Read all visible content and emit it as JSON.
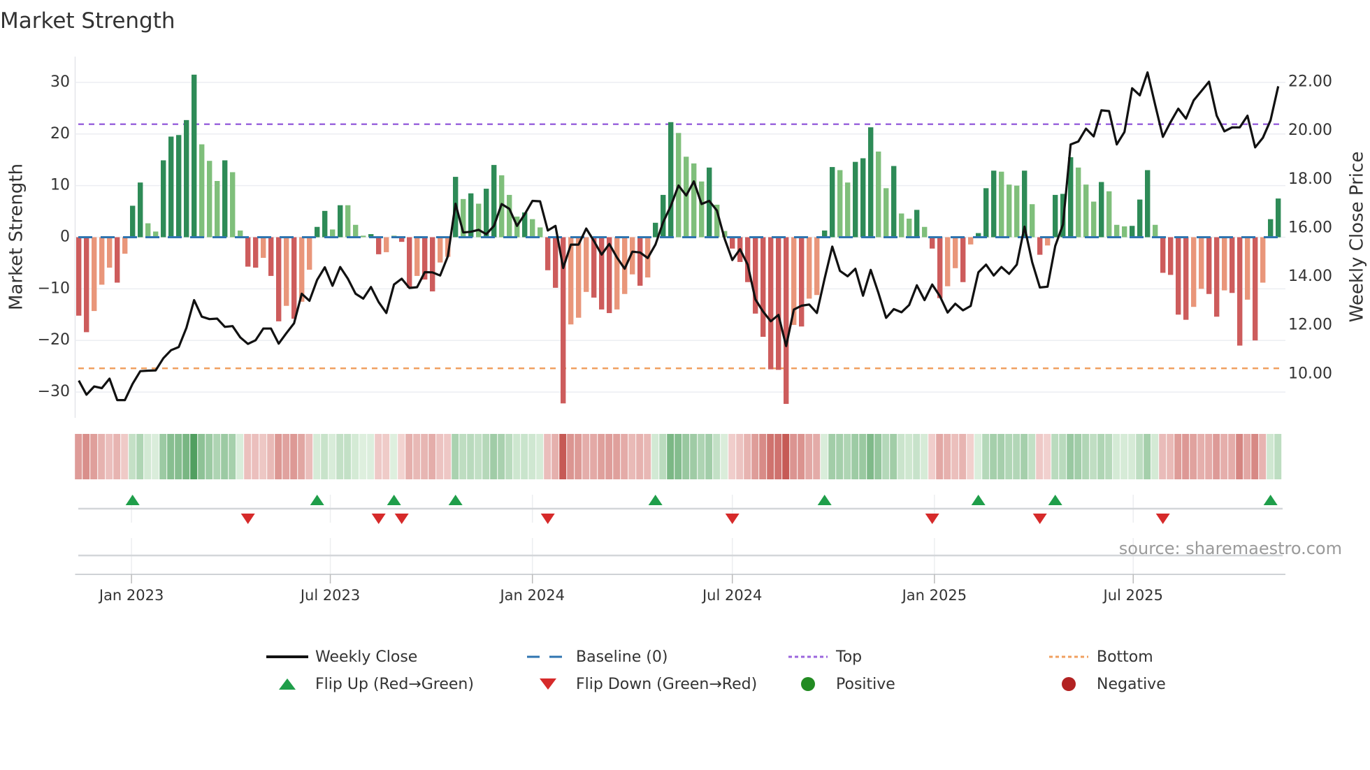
{
  "title": "Market Strength",
  "source": "source: sharemaestro.com",
  "colors": {
    "strong_pos": "#2e8b57",
    "weak_pos": "#7fbf7b",
    "strong_neg": "#cd5c5c",
    "weak_neg": "#e9967a",
    "close": "#111111",
    "baseline": "#2f74b0",
    "top": "#9b66dd",
    "bottom": "#f0a060",
    "flip_up": "#1f9e4a",
    "flip_down": "#d62a2a",
    "positive": "#228b22",
    "negative": "#b22222"
  },
  "legend": {
    "weekly_close": "Weekly Close",
    "baseline": "Baseline (0)",
    "top": "Top",
    "bottom": "Bottom",
    "flip_up": "Flip Up (Red→Green)",
    "flip_down": "Flip Down (Green→Red)",
    "positive": "Positive",
    "negative": "Negative"
  },
  "chart_data": {
    "type": "bar",
    "title": "Market Strength",
    "ylabel": "Market Strength",
    "y2label": "Weekly Close Price",
    "ylim": [
      -35,
      35
    ],
    "y2lim": [
      8.2,
      23.05
    ],
    "yticks": [
      "30",
      "20",
      "10",
      "0",
      "−10",
      "−20",
      "−30"
    ],
    "ytick_values": [
      30,
      20,
      10,
      0,
      -10,
      -20,
      -30
    ],
    "y2ticks": [
      "22.00",
      "20.00",
      "18.00",
      "16.00",
      "14.00",
      "12.00",
      "10.00"
    ],
    "y2tick_values": [
      22,
      20,
      18,
      16,
      14,
      12,
      10
    ],
    "start_date": "2022-11-14",
    "frequency": "weekly",
    "xticks": [
      {
        "label": "Jan 2023",
        "date": "2023-01-01"
      },
      {
        "label": "Jul 2023",
        "date": "2023-07-01"
      },
      {
        "label": "Jan 2024",
        "date": "2024-01-01"
      },
      {
        "label": "Jul 2024",
        "date": "2024-07-01"
      },
      {
        "label": "Jan 2025",
        "date": "2025-01-01"
      },
      {
        "label": "Jul 2025",
        "date": "2025-07-01"
      }
    ],
    "top_level": 21.9,
    "bottom_level": -25.4,
    "grid": true,
    "legend_position": "bottom",
    "strength": [
      -15.2,
      -18.4,
      -14.3,
      -9.2,
      -5.9,
      -8.8,
      -3.2,
      6.1,
      10.6,
      2.7,
      1.1,
      14.9,
      19.5,
      19.8,
      22.7,
      31.5,
      18.0,
      14.8,
      10.9,
      14.9,
      12.6,
      1.3,
      -5.7,
      -5.9,
      -4.0,
      -7.5,
      -16.3,
      -13.3,
      -15.8,
      -12.5,
      -6.3,
      2.0,
      5.1,
      1.5,
      6.2,
      6.2,
      2.4,
      0.3,
      0.6,
      -3.3,
      -2.9,
      0.3,
      -0.9,
      -9.8,
      -7.5,
      -8.2,
      -10.5,
      -4.9,
      -3.8,
      11.7,
      7.4,
      8.5,
      6.5,
      9.4,
      14.0,
      12.0,
      8.2,
      4.0,
      4.8,
      3.5,
      1.9,
      -6.4,
      -9.8,
      -32.2,
      -16.9,
      -15.6,
      -10.6,
      -11.7,
      -14.0,
      -14.7,
      -14.0,
      -11.0,
      -7.2,
      -9.4,
      -7.8,
      2.8,
      8.2,
      22.3,
      20.2,
      15.6,
      14.3,
      10.8,
      13.5,
      6.3,
      1.2,
      -2.2,
      -4.8,
      -8.7,
      -14.8,
      -19.3,
      -25.6,
      -25.7,
      -32.3,
      -17.0,
      -17.3,
      -11.9,
      -11.2,
      1.3,
      13.6,
      13.0,
      10.6,
      14.6,
      15.3,
      21.3,
      16.6,
      9.5,
      13.8,
      4.6,
      3.6,
      5.3,
      2.0,
      -2.2,
      -11.8,
      -9.5,
      -6.0,
      -8.7,
      -1.4,
      0.8,
      9.5,
      12.9,
      12.7,
      10.2,
      10.0,
      12.9,
      6.4,
      -3.4,
      -1.6,
      8.2,
      8.4,
      15.5,
      13.5,
      10.2,
      6.9,
      10.7,
      8.9,
      2.4,
      2.1,
      2.2,
      7.3,
      13.0,
      2.4,
      -6.9,
      -7.3,
      -15.0,
      -16.0,
      -13.5,
      -10.0,
      -11.0,
      -15.4,
      -10.3,
      -10.8,
      -21.0,
      -12.1,
      -20.0,
      -8.8,
      3.5,
      7.5
    ],
    "strong": [
      1,
      1,
      0,
      0,
      0,
      1,
      0,
      1,
      1,
      0,
      0,
      1,
      1,
      1,
      1,
      1,
      0,
      0,
      0,
      1,
      0,
      0,
      1,
      1,
      0,
      1,
      1,
      0,
      1,
      0,
      0,
      1,
      1,
      0,
      1,
      0,
      0,
      0,
      1,
      1,
      0,
      0,
      1,
      1,
      0,
      1,
      1,
      0,
      0,
      1,
      0,
      1,
      0,
      1,
      1,
      0,
      0,
      0,
      1,
      0,
      0,
      1,
      1,
      1,
      0,
      0,
      0,
      1,
      1,
      1,
      0,
      0,
      0,
      1,
      0,
      1,
      1,
      1,
      0,
      0,
      0,
      0,
      1,
      0,
      0,
      1,
      1,
      1,
      1,
      1,
      1,
      1,
      1,
      0,
      1,
      0,
      0,
      1,
      1,
      0,
      0,
      1,
      1,
      1,
      0,
      0,
      1,
      0,
      0,
      1,
      0,
      1,
      1,
      0,
      0,
      1,
      0,
      1,
      1,
      1,
      0,
      0,
      0,
      1,
      0,
      1,
      0,
      1,
      1,
      1,
      0,
      0,
      0,
      1,
      0,
      0,
      0,
      1,
      1,
      1,
      0,
      1,
      1,
      1,
      1,
      0,
      0,
      1,
      1,
      0,
      1,
      1,
      0,
      1,
      0,
      1,
      1
    ],
    "weekly_close": [
      9.73,
      9.15,
      9.49,
      9.42,
      9.81,
      8.93,
      8.93,
      9.6,
      10.12,
      10.14,
      10.15,
      10.65,
      10.98,
      11.11,
      11.9,
      13.04,
      12.36,
      12.26,
      12.28,
      11.94,
      11.97,
      11.51,
      11.24,
      11.39,
      11.87,
      11.87,
      11.25,
      11.68,
      12.09,
      13.3,
      13.01,
      13.87,
      14.39,
      13.63,
      14.4,
      13.92,
      13.3,
      13.1,
      13.58,
      12.96,
      12.51,
      13.68,
      13.92,
      13.54,
      13.57,
      14.19,
      14.18,
      14.05,
      14.84,
      17.0,
      15.82,
      15.85,
      15.93,
      15.75,
      16.09,
      16.99,
      16.79,
      16.09,
      16.57,
      17.12,
      17.1,
      15.9,
      16.09,
      14.36,
      15.32,
      15.32,
      15.98,
      15.47,
      14.91,
      15.35,
      14.79,
      14.33,
      15.03,
      15.0,
      14.77,
      15.32,
      16.24,
      16.91,
      17.75,
      17.34,
      17.92,
      16.99,
      17.12,
      16.72,
      15.56,
      14.69,
      15.13,
      14.5,
      13.07,
      12.57,
      12.17,
      12.43,
      11.15,
      12.65,
      12.81,
      12.86,
      12.51,
      13.92,
      15.24,
      14.24,
      14.02,
      14.33,
      13.22,
      14.28,
      13.34,
      12.31,
      12.67,
      12.54,
      12.84,
      13.65,
      13.04,
      13.68,
      13.2,
      12.53,
      12.89,
      12.62,
      12.8,
      14.18,
      14.5,
      14.05,
      14.4,
      14.12,
      14.5,
      16.06,
      14.6,
      13.56,
      13.59,
      15.27,
      16.14,
      19.44,
      19.56,
      20.09,
      19.77,
      20.84,
      20.81,
      19.44,
      19.95,
      21.75,
      21.46,
      22.4,
      21.06,
      19.75,
      20.36,
      20.91,
      20.5,
      21.25,
      21.63,
      22.02,
      20.62,
      19.98,
      20.14,
      20.14,
      20.62,
      19.32,
      19.71,
      20.43,
      21.83
    ],
    "flip_up_weeks": [
      7,
      31,
      41,
      49,
      75,
      97,
      117,
      127,
      155
    ],
    "flip_down_weeks": [
      22,
      39,
      42,
      61,
      85,
      111,
      125,
      141
    ]
  }
}
